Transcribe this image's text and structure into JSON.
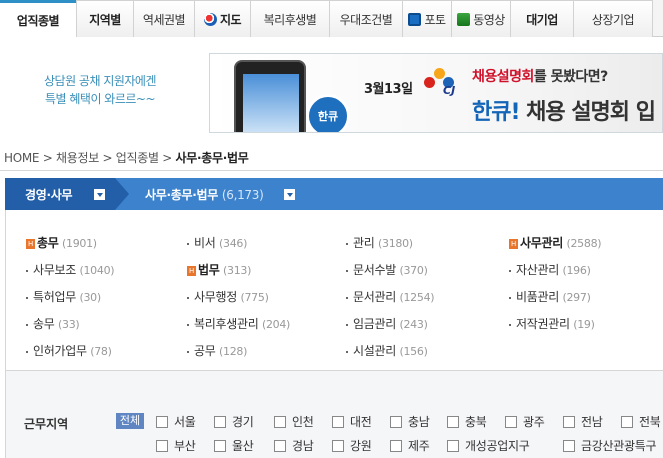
{
  "nav": {
    "tabs": [
      {
        "label": "업직종별",
        "style": "active"
      },
      {
        "label": "지역별",
        "style": "bold"
      },
      {
        "label": "역세권별",
        "style": ""
      },
      {
        "label": "지도",
        "style": "bold",
        "icon": "map-icon"
      },
      {
        "label": "복리후생별",
        "style": ""
      },
      {
        "label": "우대조건별",
        "style": ""
      },
      {
        "label": "포토",
        "style": "",
        "icon": "photo-icon"
      },
      {
        "label": "동영상",
        "style": "",
        "icon": "video-icon"
      },
      {
        "label": "대기업",
        "style": "bold"
      },
      {
        "label": "상장기업",
        "style": ""
      }
    ]
  },
  "promo": {
    "line1": "상담원 공채 지원자에겐",
    "line2": "특별 혜택이 와르르~~"
  },
  "banner": {
    "date": "3월13일",
    "logo": "CJ",
    "headline_red": "채용설명회",
    "headline_rest": "를 못봤다면?",
    "brand": "한큐!",
    "brand_rest": " 채용 설명회 입",
    "bubble": "한큐"
  },
  "breadcrumb": {
    "items": [
      "HOME",
      "채용정보",
      "업직종별"
    ],
    "separator": ">",
    "current": "사무·총무·법무"
  },
  "category": {
    "primary": "경영·사무",
    "secondary": "사무·총무·법무",
    "count": "(6,173)"
  },
  "jobs": [
    {
      "name": "총무",
      "count": "(1901)",
      "hot": true,
      "bold": true
    },
    {
      "name": "비서",
      "count": "(346)",
      "hot": false,
      "bold": false
    },
    {
      "name": "관리",
      "count": "(3180)",
      "hot": false,
      "bold": false
    },
    {
      "name": "사무관리",
      "count": "(2588)",
      "hot": true,
      "bold": true
    },
    {
      "name": "사무보조",
      "count": "(1040)",
      "hot": false,
      "bold": false
    },
    {
      "name": "법무",
      "count": "(313)",
      "hot": true,
      "bold": true
    },
    {
      "name": "문서수발",
      "count": "(370)",
      "hot": false,
      "bold": false
    },
    {
      "name": "자산관리",
      "count": "(196)",
      "hot": false,
      "bold": false
    },
    {
      "name": "특허업무",
      "count": "(30)",
      "hot": false,
      "bold": false
    },
    {
      "name": "사무행정",
      "count": "(775)",
      "hot": false,
      "bold": false
    },
    {
      "name": "문서관리",
      "count": "(1254)",
      "hot": false,
      "bold": false
    },
    {
      "name": "비품관리",
      "count": "(297)",
      "hot": false,
      "bold": false
    },
    {
      "name": "송무",
      "count": "(33)",
      "hot": false,
      "bold": false
    },
    {
      "name": "복리후생관리",
      "count": "(204)",
      "hot": false,
      "bold": false
    },
    {
      "name": "임금관리",
      "count": "(243)",
      "hot": false,
      "bold": false
    },
    {
      "name": "저작권관리",
      "count": "(19)",
      "hot": false,
      "bold": false
    },
    {
      "name": "인허가업무",
      "count": "(78)",
      "hot": false,
      "bold": false
    },
    {
      "name": "공무",
      "count": "(128)",
      "hot": false,
      "bold": false
    },
    {
      "name": "시설관리",
      "count": "(156)",
      "hot": false,
      "bold": false
    }
  ],
  "hot_badge": "H",
  "region": {
    "title": "근무지역",
    "all_label": "전체",
    "row1": [
      "서울",
      "경기",
      "인천",
      "대전",
      "충남",
      "충북",
      "광주",
      "전남",
      "전북"
    ],
    "row2": [
      "부산",
      "울산",
      "경남",
      "강원",
      "제주",
      "개성공업지구",
      "금강산관광특구"
    ]
  },
  "colors": {
    "nav_active": "#2d8fc6",
    "cat_dark": "#225fa8",
    "cat_light": "#3c82cc",
    "hot": "#e8762c",
    "promo_text": "#3a8fb8"
  }
}
